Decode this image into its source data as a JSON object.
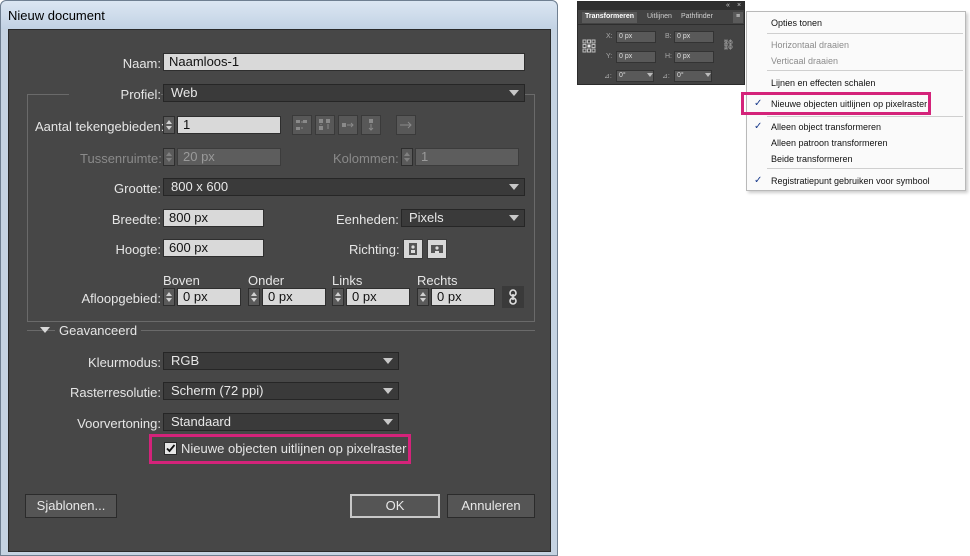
{
  "dialog": {
    "title": "Nieuw document",
    "name": {
      "label": "Naam:",
      "value": "Naamloos-1"
    },
    "profile": {
      "label": "Profiel:",
      "value": "Web"
    },
    "artboards": {
      "label": "Aantal tekengebieden:",
      "value": "1"
    },
    "spacing": {
      "label": "Tussenruimte:",
      "value": "20 px"
    },
    "columns": {
      "label": "Kolommen:",
      "value": "1"
    },
    "size": {
      "label": "Grootte:",
      "value": "800 x 600"
    },
    "width": {
      "label": "Breedte:",
      "value": "800 px"
    },
    "units": {
      "label": "Eenheden:",
      "value": "Pixels"
    },
    "height": {
      "label": "Hoogte:",
      "value": "600 px"
    },
    "orientation": {
      "label": "Richting:"
    },
    "bleed": {
      "label": "Afloopgebied:",
      "top_label": "Boven",
      "top_value": "0 px",
      "bottom_label": "Onder",
      "bottom_value": "0 px",
      "left_label": "Links",
      "left_value": "0 px",
      "right_label": "Rechts",
      "right_value": "0 px"
    },
    "advanced": {
      "label": "Geavanceerd"
    },
    "color_mode": {
      "label": "Kleurmodus:",
      "value": "RGB"
    },
    "raster": {
      "label": "Rasterresolutie:",
      "value": "Scherm (72 ppi)"
    },
    "preview": {
      "label": "Voorvertoning:",
      "value": "Standaard"
    },
    "align_pixel": {
      "label": "Nieuwe objecten uitlijnen op pixelraster",
      "checked": true
    },
    "templates_label": "Sjablonen...",
    "ok_label": "OK",
    "cancel_label": "Annuleren",
    "highlight_color": "#d4237a"
  },
  "panel": {
    "tabs": [
      "Transformeren",
      "Uitlijnen",
      "Pathfinder"
    ],
    "x_label": "X:",
    "x_value": "0 px",
    "y_label": "Y:",
    "y_value": "0 px",
    "w_label": "B:",
    "w_value": "0 px",
    "h_label": "H:",
    "h_value": "0 px",
    "angle_value": "0°",
    "shear_value": "0°"
  },
  "menu": {
    "items": [
      {
        "label": "Opties tonen",
        "checked": false,
        "enabled": true
      },
      {
        "label": "Horizontaal draaien",
        "checked": false,
        "enabled": false
      },
      {
        "label": "Verticaal draaien",
        "checked": false,
        "enabled": false
      },
      {
        "label": "Lijnen en effecten schalen",
        "checked": false,
        "enabled": true
      },
      {
        "label": "Nieuwe objecten uitlijnen op pixelraster",
        "checked": true,
        "enabled": true
      },
      {
        "label": "Alleen object transformeren",
        "checked": true,
        "enabled": true
      },
      {
        "label": "Alleen patroon transformeren",
        "checked": false,
        "enabled": true
      },
      {
        "label": "Beide transformeren",
        "checked": false,
        "enabled": true
      },
      {
        "label": "Registratiepunt gebruiken voor symbool",
        "checked": true,
        "enabled": true
      }
    ]
  }
}
